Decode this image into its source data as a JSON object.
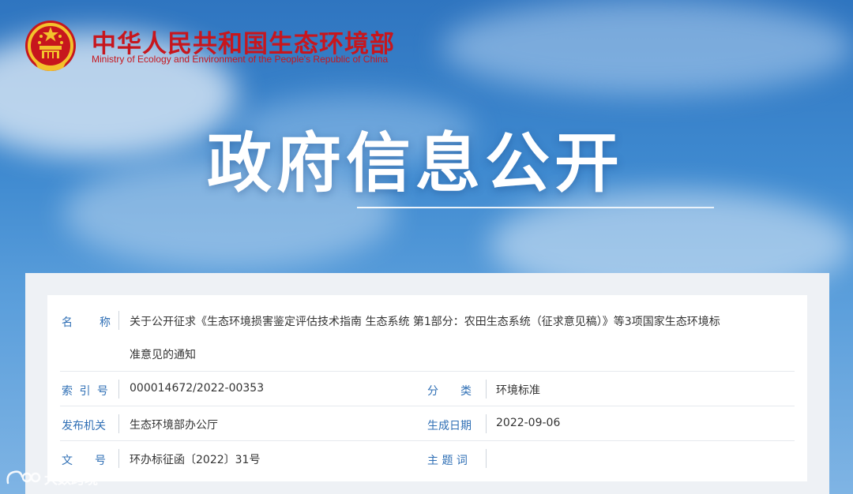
{
  "header": {
    "site_title": "中华人民共和国生态环境部",
    "site_subtitle": "Ministry of Ecology and Environment of the People's Republic of China"
  },
  "banner": {
    "title": "政府信息公开"
  },
  "record": {
    "name_label": "名　　称",
    "name_line1": "关于公开征求《生态环境损害鉴定评估技术指南 生态系统 第1部分：农田生态系统（征求意见稿）》等3项国家生态环境标",
    "name_line2": "准意见的通知",
    "index_label": "索 引 号",
    "index_value": "000014672/2022-00353",
    "category_label": "分　　类",
    "category_value": "环境标准",
    "publisher_label": "发布机关",
    "publisher_value": "生态环境部办公厅",
    "date_label": "生成日期",
    "date_value": "2022-09-06",
    "doc_no_label": "文　　号",
    "doc_no_value": "环办标征函〔2022〕31号",
    "subject_label": "主 题 词",
    "subject_value": ""
  },
  "watermark": {
    "text": "大数跨境"
  },
  "colors": {
    "brand_red": "#c7161d",
    "label_blue": "#2f6fb5"
  }
}
